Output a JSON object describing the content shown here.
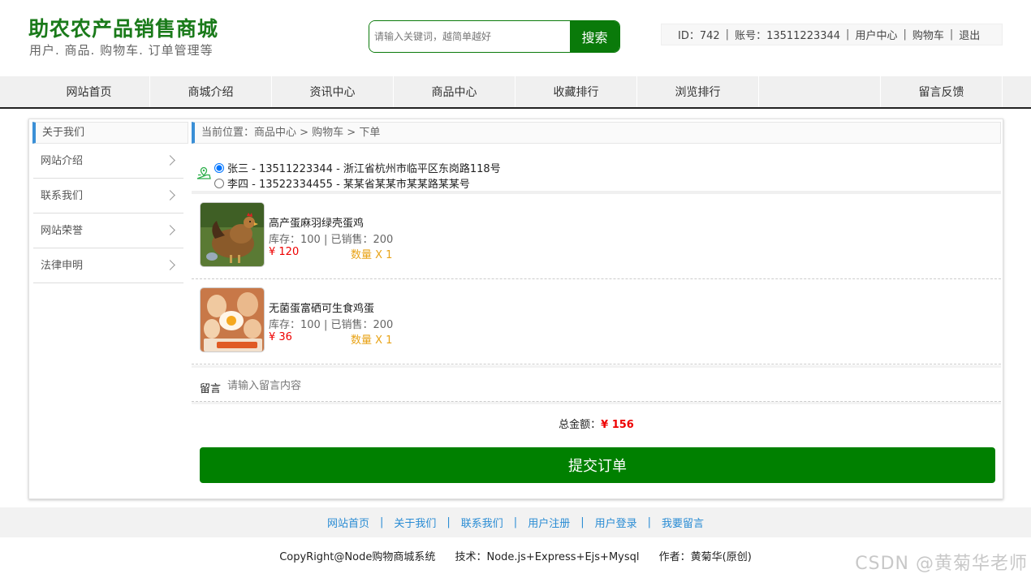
{
  "header": {
    "title": "助农农产品销售商城",
    "subtitle": "用户. 商品. 购物车. 订单管理等",
    "search_placeholder": "请输入关键词，越简单越好",
    "search_button": "搜索"
  },
  "userbar": {
    "id_text": "ID：742",
    "account_text": "账号：13511223344",
    "user_center": "用户中心",
    "cart": "购物车",
    "logout": "退出"
  },
  "nav": {
    "items": [
      "网站首页",
      "商城介绍",
      "资讯中心",
      "商品中心",
      "收藏排行",
      "浏览排行"
    ],
    "last": "留言反馈"
  },
  "sidebar": {
    "title": "关于我们",
    "items": [
      "网站介绍",
      "联系我们",
      "网站荣誉",
      "法律申明"
    ]
  },
  "breadcrumb": "当前位置：商品中心 > 购物车 > 下单",
  "addresses": [
    {
      "text": "张三 - 13511223344 - 浙江省杭州市临平区东岗路118号",
      "selected": true
    },
    {
      "text": "李四 - 13522334455 - 某某省某某市某某路某某号",
      "selected": false
    }
  ],
  "products": [
    {
      "name": "高产蛋麻羽绿壳蛋鸡",
      "meta": "库存：100 | 已销售：200",
      "price": "¥ 120",
      "qty": "数量 X 1"
    },
    {
      "name": "无菌蛋富硒可生食鸡蛋",
      "meta": "库存：100 | 已销售：200",
      "price": "¥ 36",
      "qty": "数量 X 1"
    }
  ],
  "message": {
    "label": "留言",
    "placeholder": "请输入留言内容"
  },
  "total": {
    "label": "总金额：",
    "value": "¥ 156"
  },
  "submit_label": "提交订单",
  "footer": {
    "links": [
      "网站首页",
      "关于我们",
      "联系我们",
      "用户注册",
      "用户登录",
      "我要留言"
    ],
    "copyright": "CopyRight@Node购物商城系统",
    "tech": "技术：Node.js+Express+Ejs+Mysql",
    "author": "作者：黄菊华(原创)"
  },
  "watermark": "CSDN @黄菊华老师",
  "colors": {
    "brand_green": "#0a7a0a",
    "submit_green": "#008000",
    "price_red": "#e00000",
    "qty_orange": "#e8a317",
    "link_blue": "#2a8cd4"
  }
}
